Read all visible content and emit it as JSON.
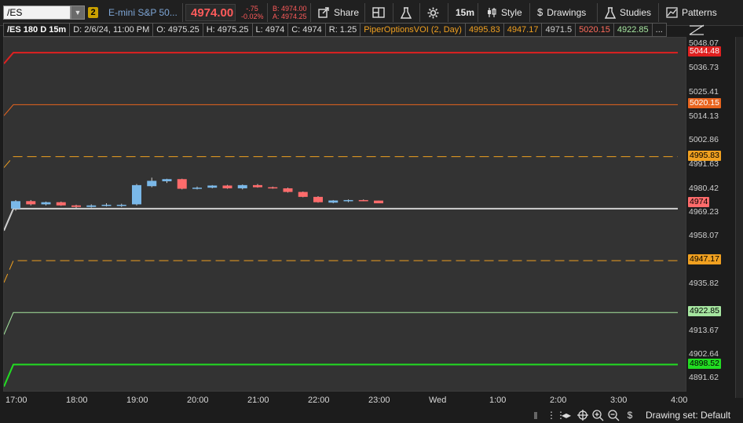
{
  "toolbar": {
    "symbol": "/ES",
    "link_group": "2",
    "description": "E-mini S&P 50...",
    "last_price": "4974.00",
    "net_change": "-.75",
    "pct_change": "-0.02%",
    "bid": "B: 4974.00",
    "ask": "A: 4974.25",
    "share_label": "Share",
    "timeframe_label": "15m",
    "style_label": "Style",
    "drawings_label": "Drawings",
    "studies_label": "Studies",
    "patterns_label": "Patterns",
    "accent_color": "#ff5b5b"
  },
  "info": {
    "symbol_label": "/ES 180 D 15m",
    "date": "D: 2/6/24, 11:00 PM",
    "open": "O: 4975.25",
    "high": "H: 4975.25",
    "low": "L: 4974",
    "close": "C: 4974",
    "range": "R: 1.25",
    "study_name": "PiperOptionsVOI (2, Day)",
    "study_values": [
      "4995.83",
      "4947.17",
      "4971.5",
      "5020.15",
      "4922.85"
    ],
    "more": "..."
  },
  "price_axis": {
    "ticks": [
      "5048.07",
      "5036.73",
      "5025.41",
      "5014.13",
      "5002.86",
      "4991.63",
      "4980.42",
      "4969.23",
      "4958.07",
      "4935.82",
      "4913.67",
      "4902.64",
      "4891.62"
    ],
    "labels": [
      {
        "text": "5044.48",
        "bg": "#e02020",
        "fg": "#ffffff"
      },
      {
        "text": "5020.15",
        "bg": "#e8641e",
        "fg": "#ffffff"
      },
      {
        "text": "4995.83",
        "bg": "#f0a020",
        "fg": "#000000"
      },
      {
        "text": "4974",
        "bg": "#ff6b6b",
        "fg": "#000000"
      },
      {
        "text": "4947.17",
        "bg": "#f0a020",
        "fg": "#000000"
      },
      {
        "text": "4922.85",
        "bg": "#a6e6a0",
        "fg": "#000000"
      },
      {
        "text": "4898.52",
        "bg": "#22dd22",
        "fg": "#000000"
      }
    ]
  },
  "time_axis": [
    "17:00",
    "18:00",
    "19:00",
    "20:00",
    "21:00",
    "22:00",
    "23:00",
    "Wed",
    "1:00",
    "2:00",
    "3:00",
    "4:00"
  ],
  "bottom": {
    "drawing_set": "Drawing set: Default"
  },
  "chart_data": {
    "type": "candlestick",
    "x_label": "",
    "y_label": "",
    "candles": [
      {
        "t": "17:00",
        "o": 4971.5,
        "h": 4975.5,
        "l": 4970.5,
        "c": 4975.0
      },
      {
        "t": "17:15",
        "o": 4975.0,
        "h": 4975.5,
        "l": 4973.0,
        "c": 4973.5
      },
      {
        "t": "17:30",
        "o": 4973.5,
        "h": 4974.8,
        "l": 4973.0,
        "c": 4974.5
      },
      {
        "t": "17:45",
        "o": 4974.5,
        "h": 4974.8,
        "l": 4972.8,
        "c": 4973.0
      },
      {
        "t": "18:00",
        "o": 4973.0,
        "h": 4973.3,
        "l": 4971.8,
        "c": 4972.3
      },
      {
        "t": "18:15",
        "o": 4972.3,
        "h": 4973.5,
        "l": 4972.0,
        "c": 4973.0
      },
      {
        "t": "18:30",
        "o": 4973.0,
        "h": 4974.0,
        "l": 4972.5,
        "c": 4973.3
      },
      {
        "t": "18:45",
        "o": 4973.3,
        "h": 4973.8,
        "l": 4972.3,
        "c": 4973.3
      },
      {
        "t": "19:00",
        "o": 4973.5,
        "h": 4983.0,
        "l": 4973.0,
        "c": 4982.5
      },
      {
        "t": "19:15",
        "o": 4982.0,
        "h": 4986.0,
        "l": 4981.5,
        "c": 4984.5
      },
      {
        "t": "19:30",
        "o": 4984.3,
        "h": 4985.5,
        "l": 4983.5,
        "c": 4985.3
      },
      {
        "t": "19:45",
        "o": 4985.3,
        "h": 4985.5,
        "l": 4980.5,
        "c": 4980.8
      },
      {
        "t": "20:00",
        "o": 4980.8,
        "h": 4981.8,
        "l": 4980.5,
        "c": 4981.3
      },
      {
        "t": "20:15",
        "o": 4981.3,
        "h": 4982.5,
        "l": 4981.0,
        "c": 4982.3
      },
      {
        "t": "20:30",
        "o": 4982.3,
        "h": 4982.6,
        "l": 4980.8,
        "c": 4981.0
      },
      {
        "t": "20:45",
        "o": 4981.0,
        "h": 4982.8,
        "l": 4980.5,
        "c": 4982.5
      },
      {
        "t": "21:00",
        "o": 4982.5,
        "h": 4983.0,
        "l": 4981.3,
        "c": 4981.5
      },
      {
        "t": "21:15",
        "o": 4981.5,
        "h": 4981.8,
        "l": 4980.8,
        "c": 4981.0
      },
      {
        "t": "21:30",
        "o": 4981.0,
        "h": 4981.3,
        "l": 4979.0,
        "c": 4979.3
      },
      {
        "t": "21:45",
        "o": 4979.3,
        "h": 4979.5,
        "l": 4976.8,
        "c": 4977.0
      },
      {
        "t": "22:00",
        "o": 4977.0,
        "h": 4977.3,
        "l": 4974.3,
        "c": 4974.5
      },
      {
        "t": "22:15",
        "o": 4974.3,
        "h": 4975.5,
        "l": 4974.0,
        "c": 4975.3
      },
      {
        "t": "22:30",
        "o": 4975.3,
        "h": 4975.8,
        "l": 4974.5,
        "c": 4975.5
      },
      {
        "t": "22:45",
        "o": 4975.5,
        "h": 4975.8,
        "l": 4975.0,
        "c": 4975.3
      },
      {
        "t": "23:00",
        "o": 4975.25,
        "h": 4975.25,
        "l": 4974.0,
        "c": 4974.0
      }
    ],
    "levels": [
      {
        "value": 5044.48,
        "color": "#e02020",
        "style": "solid",
        "width": 2
      },
      {
        "value": 5020.15,
        "color": "#e8641e",
        "style": "solid",
        "width": 1
      },
      {
        "value": 4995.83,
        "color": "#f0a020",
        "style": "dashed",
        "width": 1
      },
      {
        "value": 4971.5,
        "color": "#cfcfcf",
        "style": "solid",
        "width": 2
      },
      {
        "value": 4947.17,
        "color": "#f0a020",
        "style": "dashed",
        "width": 1
      },
      {
        "value": 4922.85,
        "color": "#a6e6a0",
        "style": "solid",
        "width": 1
      },
      {
        "value": 4898.52,
        "color": "#22dd22",
        "style": "solid",
        "width": 2
      }
    ],
    "y_range": [
      4885.5,
      5051.5
    ],
    "up_color": "#7ab8e8",
    "down_color": "#ff6b6b",
    "grid": false
  }
}
